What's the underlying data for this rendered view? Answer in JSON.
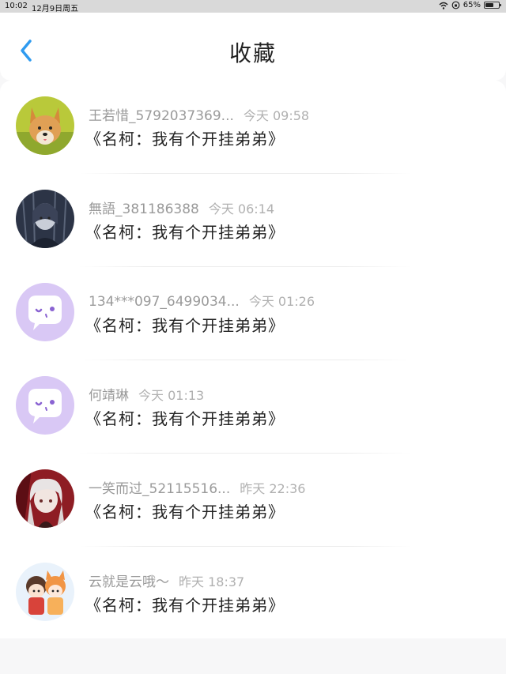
{
  "status_bar": {
    "time": "10:02",
    "date": "12月9日周五",
    "battery": "65%",
    "battery_level": 0.65
  },
  "header": {
    "title": "收藏",
    "back_icon": "chevron-left-icon",
    "accent_color": "#2f9bf0"
  },
  "favorites": [
    {
      "username": "王若惜_5792037369...",
      "time": "今天 09:58",
      "title": "《名柯：我有个开挂弟弟》",
      "avatar": "corgi-dog-avatar"
    },
    {
      "username": "無語_381186388",
      "time": "今天 06:14",
      "title": "《名柯：我有个开挂弟弟》",
      "avatar": "dark-anime-avatar"
    },
    {
      "username": "134***097_6499034...",
      "time": "今天 01:26",
      "title": "《名柯：我有个开挂弟弟》",
      "avatar": "default-chat-avatar"
    },
    {
      "username": "何靖琳",
      "time": "今天 01:13",
      "title": "《名柯：我有个开挂弟弟》",
      "avatar": "default-chat-avatar"
    },
    {
      "username": "一笑而过_52115516...",
      "time": "昨天 22:36",
      "title": "《名柯：我有个开挂弟弟》",
      "avatar": "white-hair-anime-avatar"
    },
    {
      "username": "云就是云哦～",
      "time": "昨天 18:37",
      "title": "《名柯：我有个开挂弟弟》",
      "avatar": "chibi-anime-avatar"
    }
  ]
}
